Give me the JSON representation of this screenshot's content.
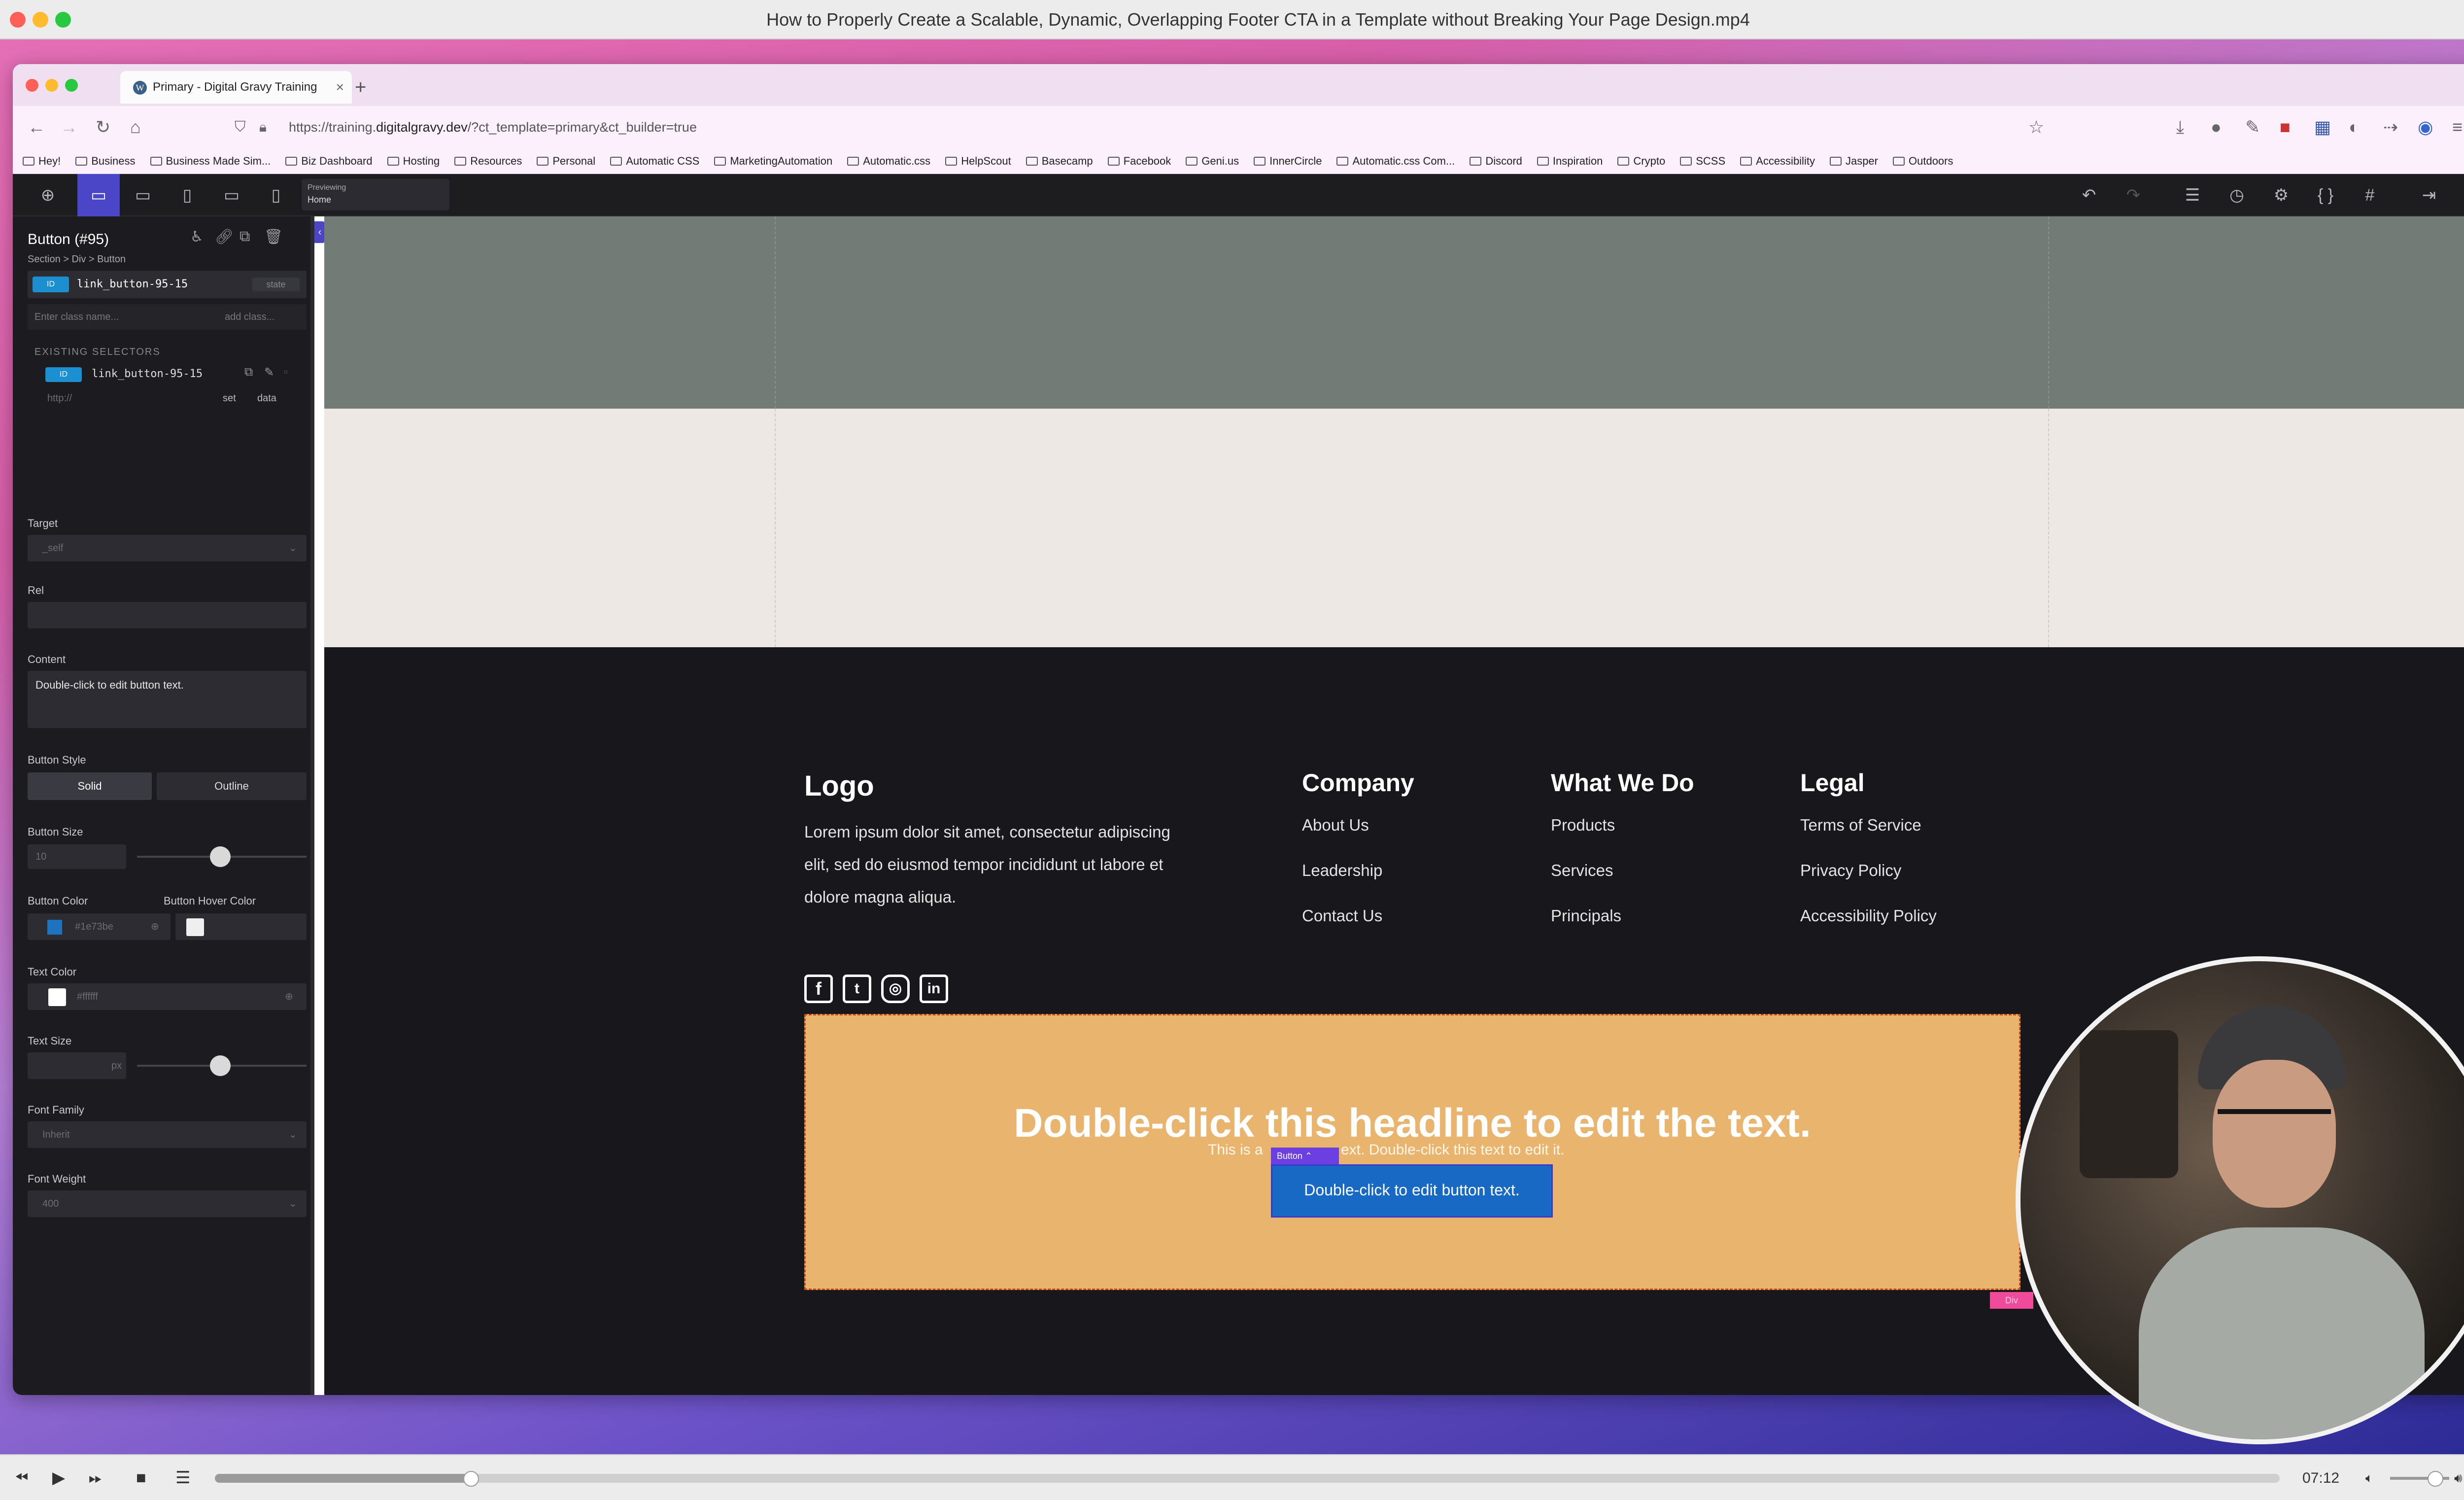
{
  "player": {
    "title": "How to Properly Create a Scalable, Dynamic, Overlapping Footer CTA in a Template without Breaking Your Page Design.mp4",
    "time": "07:12",
    "progress_fraction": 0.124
  },
  "browser": {
    "tab_title": "Primary - Digital Gravy Training",
    "url_prefix": "https://training.",
    "url_domain": "digitalgravy.dev",
    "url_suffix": "/?ct_template=primary&ct_builder=true",
    "bookmarks": [
      "Hey!",
      "Business",
      "Business Made Sim...",
      "Biz Dashboard",
      "Hosting",
      "Resources",
      "Personal",
      "Automatic CSS",
      "MarketingAutomation",
      "Automatic.css",
      "HelpScout",
      "Basecamp",
      "Facebook",
      "Geni.us",
      "InnerCircle",
      "Automatic.css Com...",
      "Discord",
      "Inspiration",
      "Crypto",
      "SCSS",
      "Accessibility",
      "Jasper",
      "Outdoors"
    ]
  },
  "builder": {
    "preview_label": "Previewing",
    "preview_page": "Home"
  },
  "sidebar": {
    "element_title": "Button (#95)",
    "breadcrumb": "Section > Div > Button",
    "selector_id": "link_button-95-15",
    "state_label": "state",
    "class_placeholder": "Enter class name...",
    "add_class": "add class...",
    "existing_selectors_label": "EXISTING SELECTORS",
    "existing_selector": "link_button-95-15",
    "url_placeholder": "http://",
    "set_label": "set",
    "data_label": "data",
    "target_label": "Target",
    "target_value": "_self",
    "rel_label": "Rel",
    "content_label": "Content",
    "content_value": "Double-click to edit button text.",
    "button_style_label": "Button Style",
    "style_solid": "Solid",
    "style_outline": "Outline",
    "button_size_label": "Button Size",
    "button_size_value": "10",
    "button_color_label": "Button Color",
    "button_color_value": "#1e73be",
    "button_hover_label": "Button Hover Color",
    "text_color_label": "Text Color",
    "text_color_value": "#ffffff",
    "text_size_label": "Text Size",
    "text_size_unit": "px",
    "font_family_label": "Font Family",
    "font_family_value": "Inherit",
    "font_weight_label": "Font Weight",
    "font_weight_value": "400"
  },
  "footer": {
    "logo": "Logo",
    "about": "Lorem ipsum dolor sit amet, consectetur adipiscing elit, sed do eiusmod tempor incididunt ut labore et dolore magna aliqua.",
    "columns": [
      {
        "heading": "Company",
        "links": [
          "About Us",
          "Leadership",
          "Contact Us"
        ]
      },
      {
        "heading": "What We Do",
        "links": [
          "Products",
          "Services",
          "Principals"
        ]
      },
      {
        "heading": "Legal",
        "links": [
          "Terms of Service",
          "Privacy Policy",
          "Accessibility Policy"
        ]
      }
    ],
    "social": [
      "facebook-icon",
      "twitter-icon",
      "instagram-icon",
      "linkedin-icon"
    ]
  },
  "cta": {
    "headline": "Double-click this headline to edit the text.",
    "text_left": "This is a",
    "text_right": "ext. Double-click this text to edit it.",
    "button_tag": "Button",
    "button_text": "Double-click to edit button text.",
    "div_tag": "Div"
  },
  "colors": {
    "builder_accent": "#4b45c8",
    "cta_background": "#e9b56e",
    "button_blue": "#1e73be",
    "footer_bg": "#17171c"
  }
}
